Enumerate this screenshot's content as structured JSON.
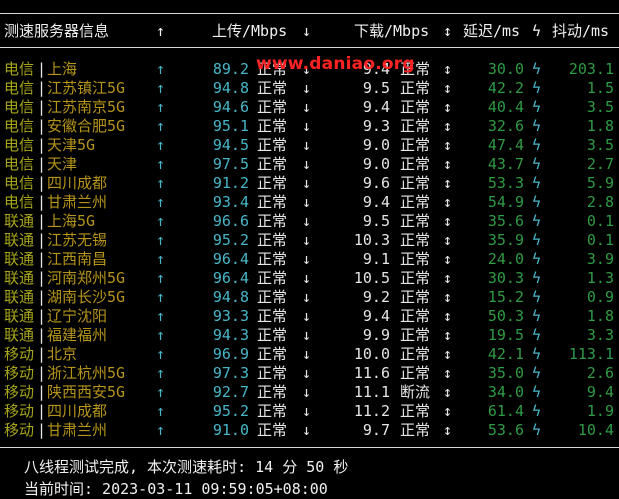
{
  "terminal": {
    "top_fragment": "  ‧ ‧ ‧  ‧ ‧ ‧  ‧ ‧ ‧  ‧ ‧ ‧",
    "header": {
      "title": "测速服务器信息",
      "title_arrow": "↑",
      "upload": "上传/Mbps",
      "upload_arrow": "↓",
      "download": "下载/Mbps",
      "download_arrow": "↕",
      "latency": "延迟/ms",
      "latency_icon": "ϟ",
      "jitter": "抖动/ms"
    },
    "watermark": "www.daniao.org",
    "rows": [
      {
        "isp": "电信",
        "city": "上海",
        "up": "89.2",
        "up_status": "正常",
        "down": "9.4",
        "down_status": "正常",
        "lat": "30.0",
        "jit": "203.1"
      },
      {
        "isp": "电信",
        "city": "江苏镇江5G",
        "up": "94.8",
        "up_status": "正常",
        "down": "9.5",
        "down_status": "正常",
        "lat": "42.2",
        "jit": "1.5"
      },
      {
        "isp": "电信",
        "city": "江苏南京5G",
        "up": "94.6",
        "up_status": "正常",
        "down": "9.4",
        "down_status": "正常",
        "lat": "40.4",
        "jit": "3.5"
      },
      {
        "isp": "电信",
        "city": "安徽合肥5G",
        "up": "95.1",
        "up_status": "正常",
        "down": "9.3",
        "down_status": "正常",
        "lat": "32.6",
        "jit": "1.8"
      },
      {
        "isp": "电信",
        "city": "天津5G",
        "up": "94.5",
        "up_status": "正常",
        "down": "9.0",
        "down_status": "正常",
        "lat": "47.4",
        "jit": "3.5"
      },
      {
        "isp": "电信",
        "city": "天津",
        "up": "97.5",
        "up_status": "正常",
        "down": "9.0",
        "down_status": "正常",
        "lat": "43.7",
        "jit": "2.7"
      },
      {
        "isp": "电信",
        "city": "四川成都",
        "up": "91.2",
        "up_status": "正常",
        "down": "9.6",
        "down_status": "正常",
        "lat": "53.3",
        "jit": "5.9"
      },
      {
        "isp": "电信",
        "city": "甘肃兰州",
        "up": "93.4",
        "up_status": "正常",
        "down": "9.4",
        "down_status": "正常",
        "lat": "54.9",
        "jit": "2.8"
      },
      {
        "isp": "联通",
        "city": "上海5G",
        "up": "96.6",
        "up_status": "正常",
        "down": "9.5",
        "down_status": "正常",
        "lat": "35.6",
        "jit": "0.1"
      },
      {
        "isp": "联通",
        "city": "江苏无锡",
        "up": "95.2",
        "up_status": "正常",
        "down": "10.3",
        "down_status": "正常",
        "lat": "35.9",
        "jit": "0.1"
      },
      {
        "isp": "联通",
        "city": "江西南昌",
        "up": "96.4",
        "up_status": "正常",
        "down": "9.1",
        "down_status": "正常",
        "lat": "24.0",
        "jit": "3.9"
      },
      {
        "isp": "联通",
        "city": "河南郑州5G",
        "up": "96.4",
        "up_status": "正常",
        "down": "10.5",
        "down_status": "正常",
        "lat": "30.3",
        "jit": "1.3"
      },
      {
        "isp": "联通",
        "city": "湖南长沙5G",
        "up": "94.8",
        "up_status": "正常",
        "down": "9.2",
        "down_status": "正常",
        "lat": "15.2",
        "jit": "0.9"
      },
      {
        "isp": "联通",
        "city": "辽宁沈阳",
        "up": "93.3",
        "up_status": "正常",
        "down": "9.4",
        "down_status": "正常",
        "lat": "50.3",
        "jit": "1.8"
      },
      {
        "isp": "联通",
        "city": "福建福州",
        "up": "94.3",
        "up_status": "正常",
        "down": "9.9",
        "down_status": "正常",
        "lat": "19.5",
        "jit": "3.3"
      },
      {
        "isp": "移动",
        "city": "北京",
        "up": "96.9",
        "up_status": "正常",
        "down": "10.0",
        "down_status": "正常",
        "lat": "42.1",
        "jit": "113.1"
      },
      {
        "isp": "移动",
        "city": "浙江杭州5G",
        "up": "97.3",
        "up_status": "正常",
        "down": "11.6",
        "down_status": "正常",
        "lat": "35.0",
        "jit": "2.6"
      },
      {
        "isp": "移动",
        "city": "陕西西安5G",
        "up": "92.7",
        "up_status": "正常",
        "down": "11.1",
        "down_status": "断流",
        "lat": "34.0",
        "jit": "9.4"
      },
      {
        "isp": "移动",
        "city": "四川成都",
        "up": "95.2",
        "up_status": "正常",
        "down": "11.2",
        "down_status": "正常",
        "lat": "61.4",
        "jit": "1.9"
      },
      {
        "isp": "移动",
        "city": "甘肃兰州",
        "up": "91.0",
        "up_status": "正常",
        "down": "9.7",
        "down_status": "正常",
        "lat": "53.6",
        "jit": "10.4"
      }
    ],
    "separator": "|",
    "row_up_arrow": "↑",
    "row_up_status_arrow": "↓",
    "row_down_status_arrow": "↕",
    "row_lat_icon": "ϟ",
    "footer_line1": "八线程测试完成, 本次测速耗时: 14 分 50 秒",
    "footer_line2": "当前时间: 2023-03-11 09:59:05+08:00"
  },
  "colors": {
    "background": "#000000",
    "isp": "#a6a51a",
    "city": "#b5941b",
    "upload": "#48b6c8",
    "latency": "#2f9b44",
    "watermark": "#ff2222"
  }
}
